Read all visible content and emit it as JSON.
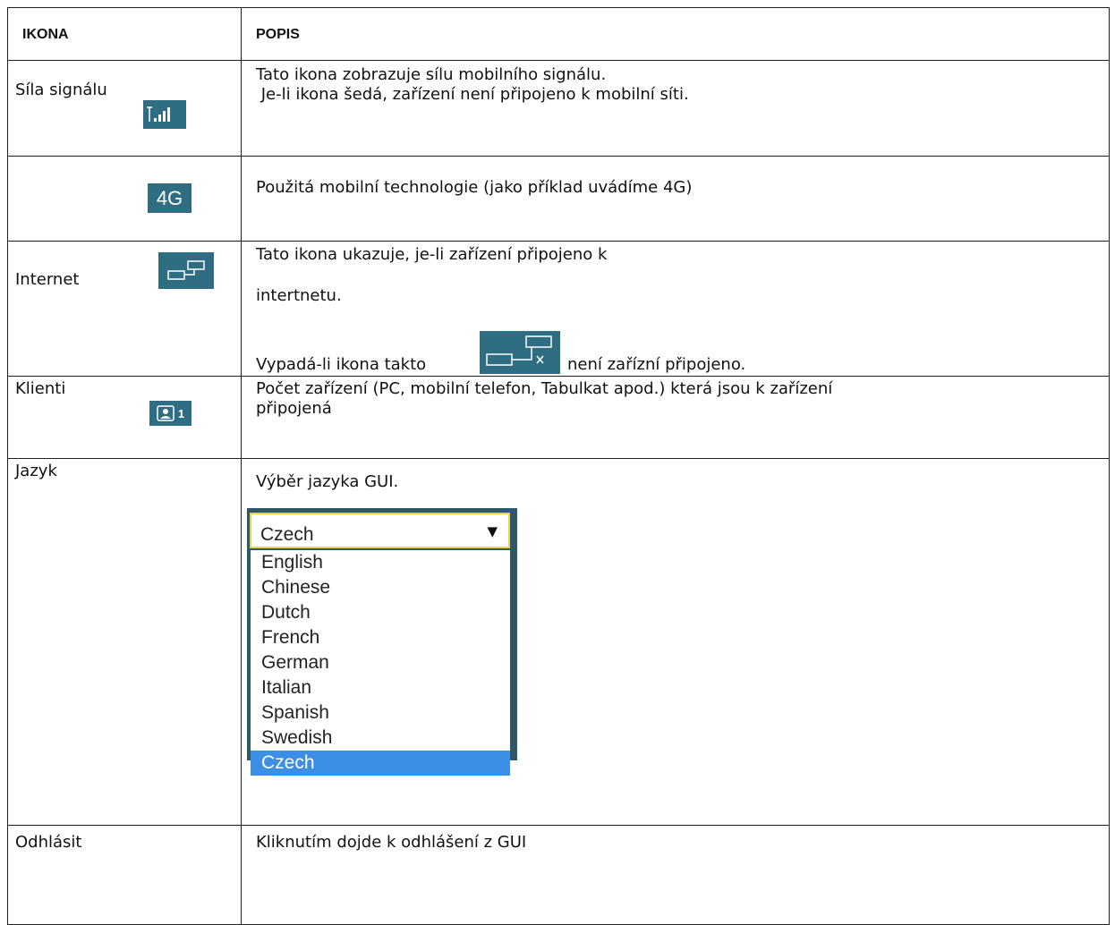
{
  "header": {
    "icon_col": "IKONA",
    "desc_col": "POPIS"
  },
  "rows": {
    "signal": {
      "label": "Síla signálu",
      "desc_line1": "Tato ikona zobrazuje sílu mobilního signálu.",
      "desc_line2": " Je-li ikona šedá, zařízení není připojeno k mobilní síti."
    },
    "tech": {
      "icon_text": "4G",
      "desc": "Použitá mobilní technologie (jako příklad uvádíme 4G)"
    },
    "internet": {
      "label": "Internet",
      "desc_line1": "Tato ikona ukazuje, je-li zařízení připojeno k",
      "desc_line2": "intertnetu.",
      "desc_line3_before": "Vypadá-li ikona takto",
      "desc_line3_after": "není zařízní připojeno."
    },
    "clients": {
      "label": "Klienti",
      "icon_count": "1",
      "desc_line1": "Počet zařízení (PC, mobilní telefon, Tabulkat apod.) která jsou k zařízení",
      "desc_line2": "připojená"
    },
    "language": {
      "label": "Jazyk",
      "desc": "Výběr jazyka GUI.",
      "selected": "Czech",
      "options": [
        "English",
        "Chinese",
        "Dutch",
        "French",
        "German",
        "Italian",
        "Spanish",
        "Swedish",
        "Czech"
      ]
    },
    "logout": {
      "label": "Odhlásit",
      "desc": "Kliknutím dojde k odhlášení z GUI"
    }
  },
  "colors": {
    "icon_bg": "#2f6e82",
    "dropdown_bg": "#2e5866",
    "selected_option": "#3c8fe5"
  }
}
